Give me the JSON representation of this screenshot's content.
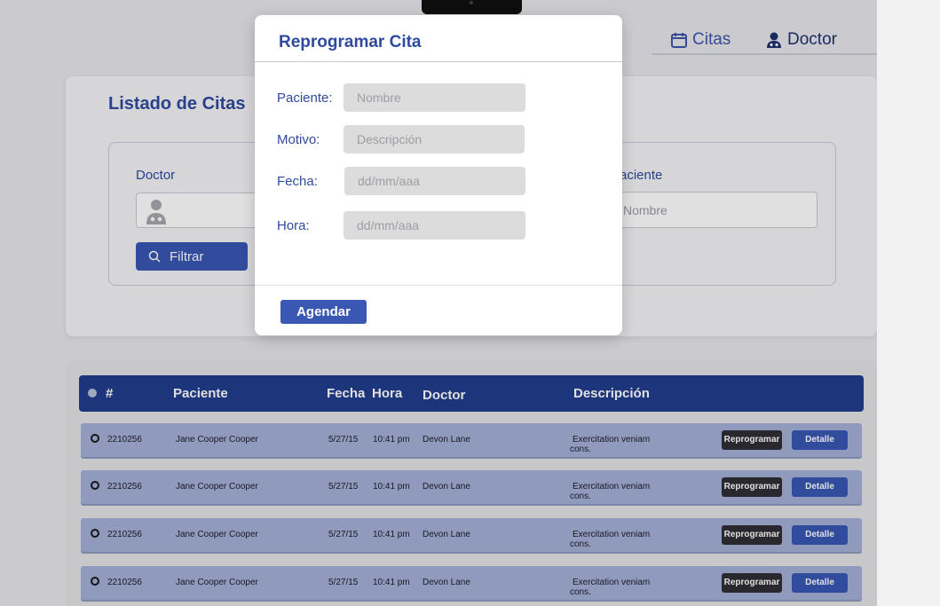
{
  "nav": {
    "citas_label": "Citas",
    "doctor_label": "Doctor"
  },
  "filter_panel": {
    "title": "Listado de Citas",
    "doctor_label": "Doctor",
    "paciente_label_partial": "aciente",
    "paciente_placeholder_partial": "Nombre",
    "filter_button": "Filtrar"
  },
  "table": {
    "headers": [
      "#",
      "Paciente",
      "Fecha",
      "Hora",
      "Doctor",
      "Descripción"
    ],
    "rows": [
      {
        "id": "2210256",
        "paciente": "Jane Cooper Cooper",
        "fecha": "5/27/15",
        "hora": "10:41 pm",
        "doctor": "Devon Lane",
        "desc_1": "Exercitation veniam",
        "desc_2": "cons.",
        "rep": "Reprogramar",
        "det": "Detalle"
      },
      {
        "id": "2210256",
        "paciente": "Jane Cooper Cooper",
        "fecha": "5/27/15",
        "hora": "10:41 pm",
        "doctor": "Devon Lane",
        "desc_1": "Exercitation veniam",
        "desc_2": "cons.",
        "rep": "Reprogramar",
        "det": "Detalle"
      },
      {
        "id": "2210256",
        "paciente": "Jane Cooper Cooper",
        "fecha": "5/27/15",
        "hora": "10:41 pm",
        "doctor": "Devon Lane",
        "desc_1": "Exercitation veniam",
        "desc_2": "cons.",
        "rep": "Reprogramar",
        "det": "Detalle"
      },
      {
        "id": "2210256",
        "paciente": "Jane Cooper Cooper",
        "fecha": "5/27/15",
        "hora": "10:41 pm",
        "doctor": "Devon Lane",
        "desc_1": "Exercitation veniam",
        "desc_2": "cons.",
        "rep": "Reprogramar",
        "det": "Detalle"
      }
    ]
  },
  "modal": {
    "title": "Reprogramar Cita",
    "fields": [
      {
        "label": "Paciente:",
        "placeholder": "Nombre"
      },
      {
        "label": "Motivo:",
        "placeholder": "Descripción"
      },
      {
        "label": "Fecha:",
        "placeholder": "dd/mm/aaa"
      },
      {
        "label": "Hora:",
        "placeholder": "dd/mm/aaa"
      }
    ],
    "submit_label": "Agendar"
  },
  "colors": {
    "primary": "#3a57b3",
    "header_dark": "#213e8c",
    "row_bg": "#a3b0d8",
    "title_text": "#2e4a9e"
  }
}
